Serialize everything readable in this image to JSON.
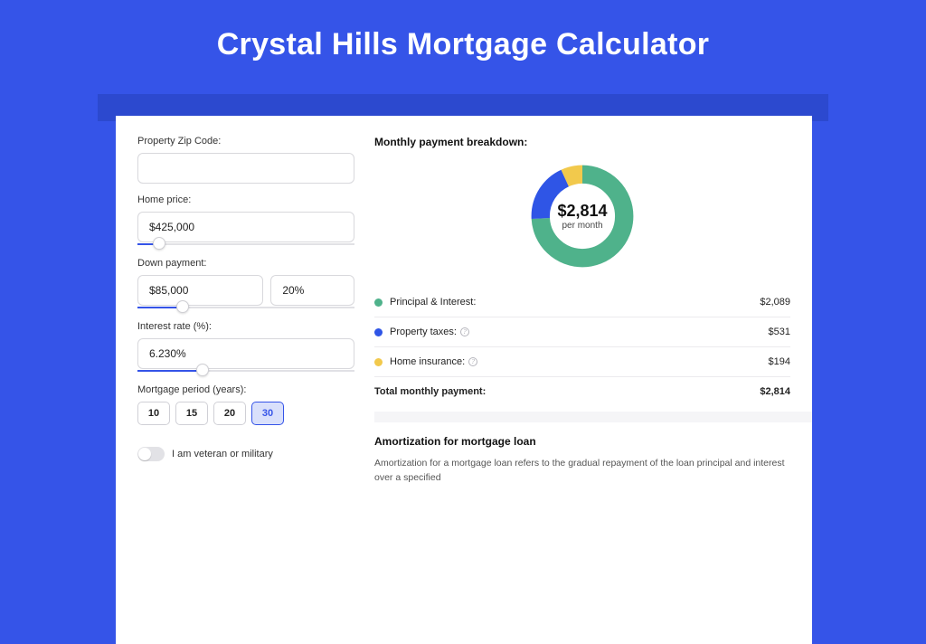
{
  "page": {
    "title": "Crystal Hills Mortgage Calculator"
  },
  "colors": {
    "principal": "#4fb28b",
    "tax": "#2f55e6",
    "insurance": "#f2c94c"
  },
  "form": {
    "zip": {
      "label": "Property Zip Code:",
      "value": ""
    },
    "homePrice": {
      "label": "Home price:",
      "value": "$425,000",
      "slider_pct": 10
    },
    "downPayment": {
      "label": "Down payment:",
      "amount": "$85,000",
      "percent": "20%",
      "slider_pct": 21
    },
    "interest": {
      "label": "Interest rate (%):",
      "value": "6.230%",
      "slider_pct": 30
    },
    "period": {
      "label": "Mortgage period (years):",
      "options": [
        "10",
        "15",
        "20",
        "30"
      ],
      "selected": "30"
    },
    "veteran": {
      "label": "I am veteran or military",
      "checked": false
    }
  },
  "breakdown": {
    "title": "Monthly payment breakdown:",
    "total_big": "$2,814",
    "total_sub": "per month",
    "rows": [
      {
        "key": "principal",
        "label": "Principal & Interest:",
        "value": "$2,089",
        "pct": 74,
        "info": false
      },
      {
        "key": "tax",
        "label": "Property taxes:",
        "value": "$531",
        "pct": 19,
        "info": true
      },
      {
        "key": "insurance",
        "label": "Home insurance:",
        "value": "$194",
        "pct": 7,
        "info": true
      }
    ],
    "total_label": "Total monthly payment:",
    "total_value": "$2,814"
  },
  "amortization": {
    "title": "Amortization for mortgage loan",
    "text": "Amortization for a mortgage loan refers to the gradual repayment of the loan principal and interest over a specified"
  },
  "chart_data": {
    "type": "pie",
    "title": "Monthly payment breakdown",
    "categories": [
      "Principal & Interest",
      "Property taxes",
      "Home insurance"
    ],
    "values": [
      2089,
      531,
      194
    ],
    "total": 2814,
    "unit": "$ per month",
    "colors": [
      "#4fb28b",
      "#2f55e6",
      "#f2c94c"
    ]
  }
}
